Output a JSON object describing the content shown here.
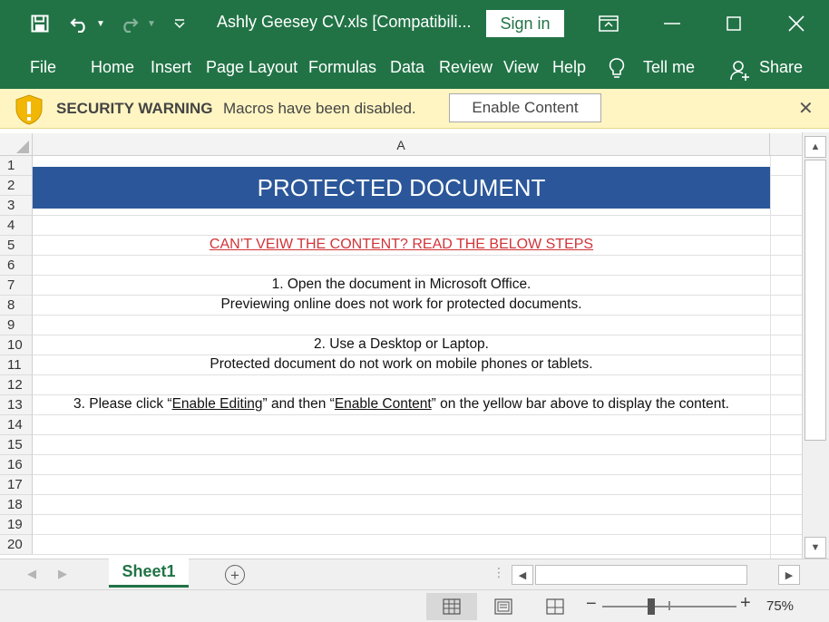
{
  "titlebar": {
    "title": "Ashly Geesey CV.xls  [Compatibili...",
    "sign_in": "Sign in"
  },
  "ribbon": {
    "tabs": [
      "File",
      "Home",
      "Insert",
      "Page Layout",
      "Formulas",
      "Data",
      "Review",
      "View",
      "Help"
    ],
    "tell_me": "Tell me",
    "share": "Share"
  },
  "security": {
    "title": "SECURITY WARNING",
    "message": "Macros have been disabled.",
    "button": "Enable Content",
    "close": "✕"
  },
  "sheet": {
    "column_header": "A",
    "row_numbers": [
      "1",
      "2",
      "3",
      "4",
      "5",
      "6",
      "7",
      "8",
      "9",
      "10",
      "11",
      "12",
      "13",
      "14",
      "15",
      "16",
      "17",
      "18",
      "19",
      "20"
    ],
    "banner": "PROTECTED DOCUMENT",
    "heading": "CAN’T VEIW THE CONTENT? READ THE BELOW STEPS",
    "step1_line1": "1. Open the document in Microsoft Office.",
    "step1_line2": "Previewing online does not work for protected documents.",
    "step2_line1": "2. Use a Desktop or Laptop.",
    "step2_line2": "Protected document do not work on mobile phones or tablets.",
    "step3_prefix": "3.  Please click “",
    "step3_link1": "Enable Editing",
    "step3_mid": "” and then “",
    "step3_link2": "Enable Content",
    "step3_suffix": "” on the yellow bar above to display the content."
  },
  "tabs_bar": {
    "sheet_tab": "Sheet1",
    "add_sheet": "+"
  },
  "status": {
    "zoom": "75%",
    "zoom_level": 0.75
  },
  "colors": {
    "excel_green": "#217346",
    "banner_blue": "#2b579a",
    "warning_yellow": "#fff5c2",
    "link_red": "#d13438"
  }
}
